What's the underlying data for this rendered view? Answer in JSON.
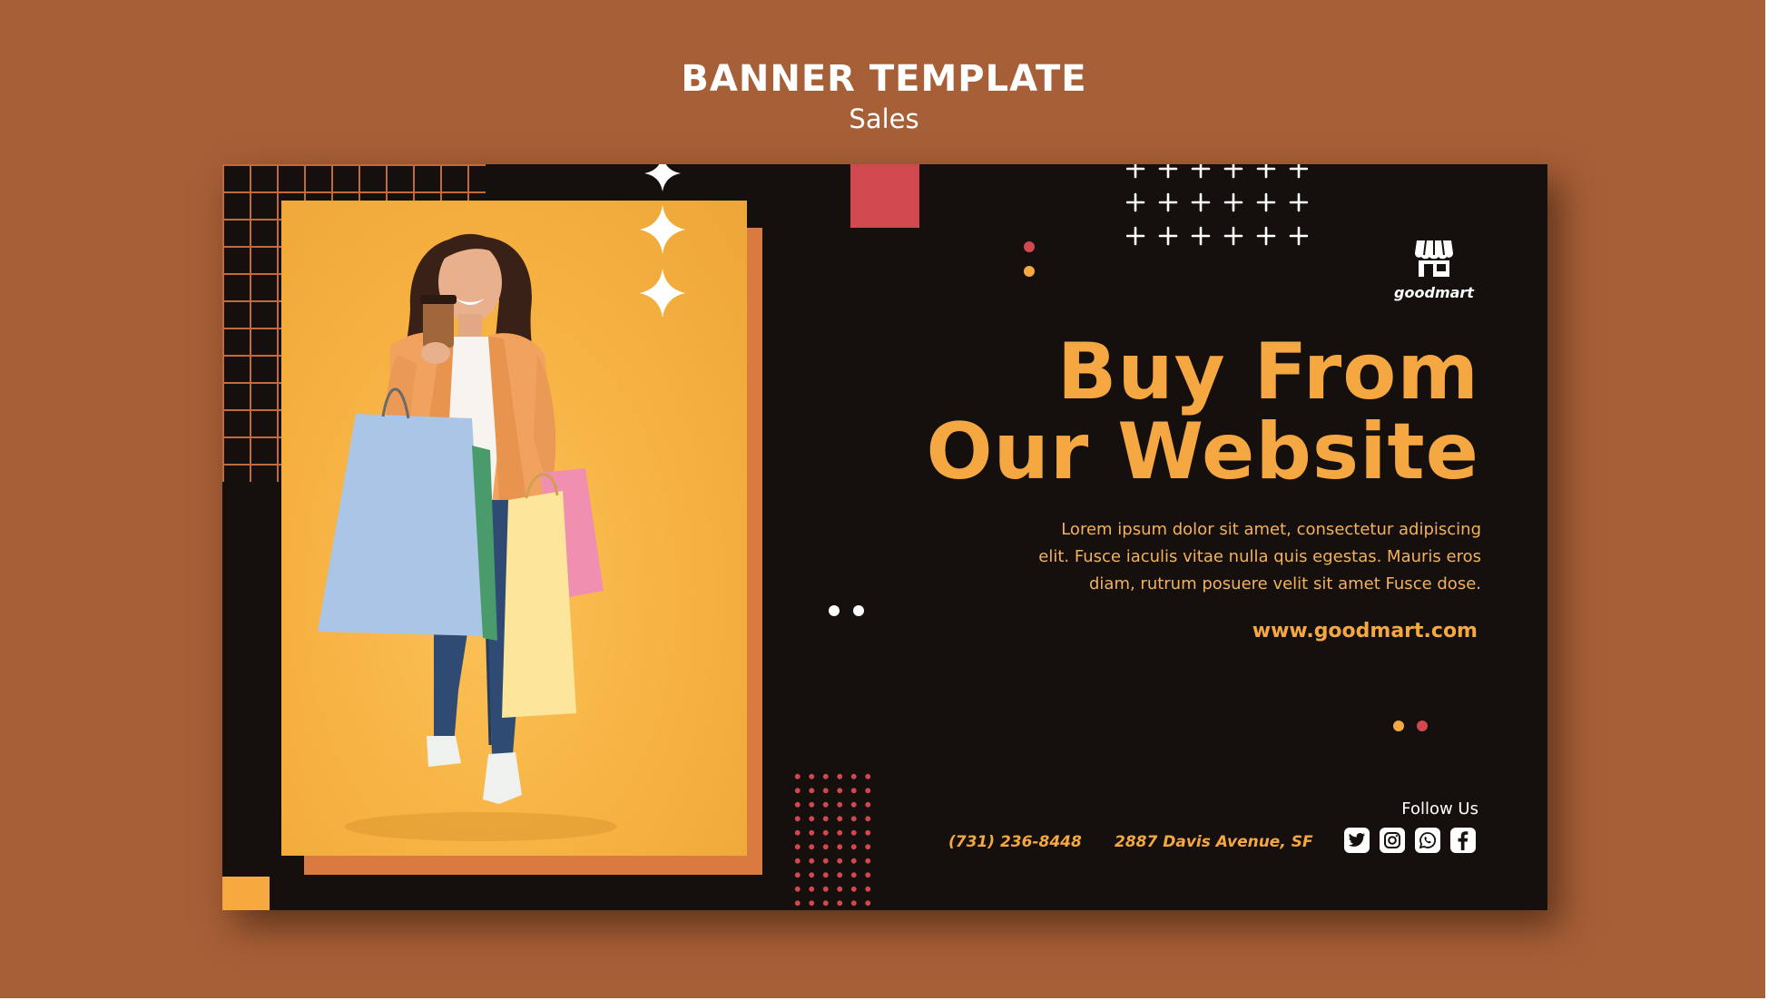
{
  "header": {
    "title": "BANNER TEMPLATE",
    "subtitle": "Sales"
  },
  "banner": {
    "brand": {
      "name": "goodmart",
      "icon": "storefront-icon"
    },
    "headline": {
      "line1": "Buy From",
      "line2": "Our Website"
    },
    "body": {
      "line1": "Lorem ipsum dolor sit amet, consectetur adipiscing",
      "line2": "elit. Fusce iaculis vitae nulla quis egestas. Mauris eros",
      "line3": "diam, rutrum posuere velit sit amet Fusce dose."
    },
    "website": "www.goodmart.com",
    "follow_label": "Follow Us",
    "phone": "(731) 236-8448",
    "address": "2887  Davis Avenue, SF",
    "social": [
      {
        "icon": "twitter-icon"
      },
      {
        "icon": "instagram-icon"
      },
      {
        "icon": "whatsapp-icon"
      },
      {
        "icon": "facebook-icon"
      }
    ]
  },
  "colors": {
    "page_background": "#a65f37",
    "banner_background": "#15100d",
    "accent_orange": "#f5a741",
    "accent_red": "#d2484f",
    "photo_background": "#f6b140"
  }
}
